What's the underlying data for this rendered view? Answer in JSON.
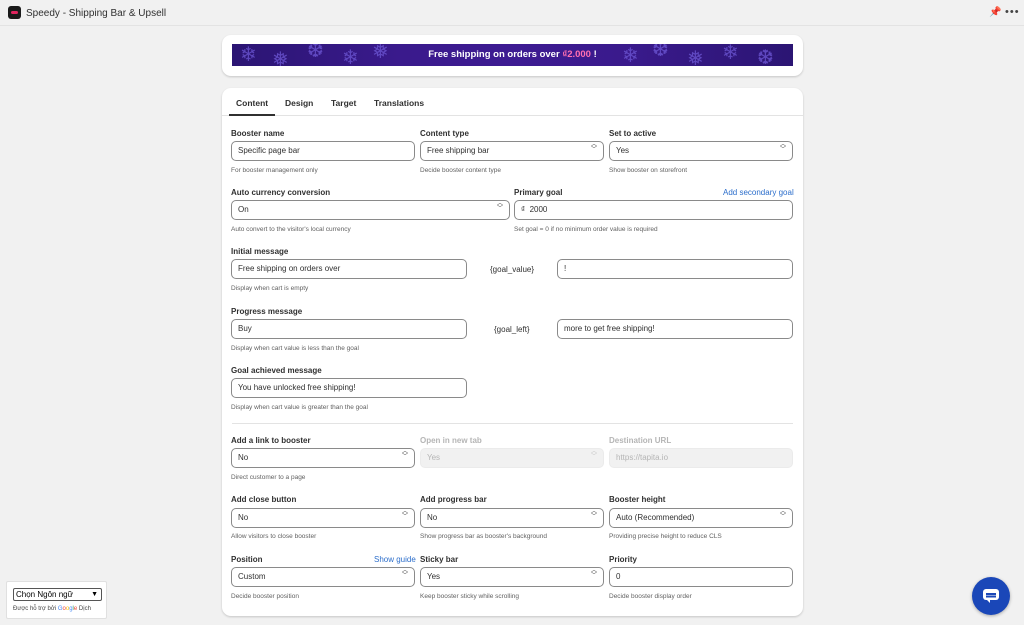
{
  "app": {
    "title": "Speedy - Shipping Bar & Upsell",
    "pin_icon": "pin-icon",
    "more_icon": "more-icon",
    "more_glyph": "•••"
  },
  "preview": {
    "text_before": "Free shipping on orders over ",
    "amount": "₫2.000",
    "text_after": " !",
    "background": "#3a1a8c",
    "amount_color": "#ff6fb0"
  },
  "tabs": [
    {
      "label": "Content",
      "active": true
    },
    {
      "label": "Design"
    },
    {
      "label": "Target"
    },
    {
      "label": "Translations"
    }
  ],
  "form": {
    "booster_name": {
      "label": "Booster name",
      "value": "Specific page bar",
      "help": "For booster management only"
    },
    "content_type": {
      "label": "Content type",
      "value": "Free shipping bar",
      "help": "Decide booster content type"
    },
    "set_active": {
      "label": "Set to active",
      "value": "Yes",
      "help": "Show booster on storefront"
    },
    "auto_currency": {
      "label": "Auto currency conversion",
      "value": "On",
      "help": "Auto convert to the visitor's local currency"
    },
    "primary_goal": {
      "label": "Primary goal",
      "link": "Add secondary goal",
      "prefix": "₫",
      "value": "2000",
      "help": "Set goal = 0 if no minimum order value is required"
    },
    "initial_message": {
      "label": "Initial message",
      "value": "Free shipping on orders over",
      "token": "{goal_value}",
      "suffix": "!",
      "help": "Display when cart is empty"
    },
    "progress_message": {
      "label": "Progress message",
      "value": "Buy",
      "token": "{goal_left}",
      "suffix": "more to get free shipping!",
      "help": "Display when cart value is less than the goal"
    },
    "goal_achieved": {
      "label": "Goal achieved message",
      "value": "You have unlocked free shipping!",
      "help": "Display when cart value is greater than the goal"
    },
    "add_link": {
      "label": "Add a link to booster",
      "value": "No",
      "help": "Direct customer to a page"
    },
    "open_new_tab": {
      "label": "Open in new tab",
      "value": "Yes"
    },
    "destination_url": {
      "label": "Destination URL",
      "placeholder": "https://tapita.io"
    },
    "close_button": {
      "label": "Add close button",
      "value": "No",
      "help": "Allow visitors to close booster"
    },
    "progress_bar": {
      "label": "Add progress bar",
      "value": "No",
      "help": "Show progress bar as booster's background"
    },
    "booster_height": {
      "label": "Booster height",
      "value": "Auto (Recommended)",
      "help": "Providing precise height to reduce CLS"
    },
    "position": {
      "label": "Position",
      "link": "Show guide",
      "value": "Custom",
      "help": "Decide booster position"
    },
    "sticky_bar": {
      "label": "Sticky bar",
      "value": "Yes",
      "help": "Keep booster sticky while scrolling"
    },
    "priority": {
      "label": "Priority",
      "value": "0",
      "help": "Decide booster display order"
    }
  },
  "translate_widget": {
    "select_value": "Chọn Ngôn ngữ",
    "note_prefix": "Được hỗ trợ bởi ",
    "brand": [
      "G",
      "o",
      "o",
      "g",
      "l",
      "e"
    ],
    "note_suffix": " Dịch"
  },
  "chat": {
    "icon": "chat-icon",
    "color": "#1a47b8"
  }
}
